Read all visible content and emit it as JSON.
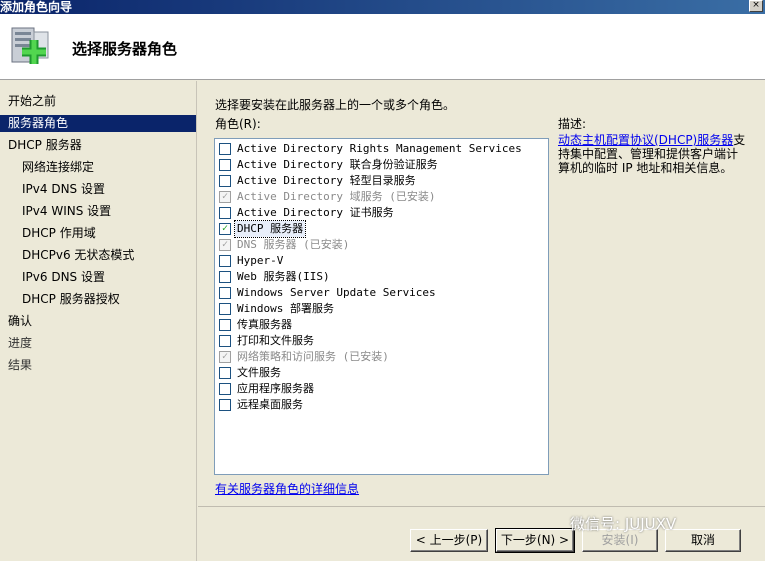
{
  "window": {
    "title": "添加角色向导",
    "close_glyph": "×"
  },
  "header": {
    "heading": "选择服务器角色",
    "icon": "server-add-icon"
  },
  "sidebar": {
    "items": [
      {
        "label": "开始之前",
        "level": 0,
        "state": "normal"
      },
      {
        "label": "服务器角色",
        "level": 0,
        "state": "active"
      },
      {
        "label": "DHCP 服务器",
        "level": 0,
        "state": "normal"
      },
      {
        "label": "网络连接绑定",
        "level": 1,
        "state": "normal"
      },
      {
        "label": "IPv4 DNS 设置",
        "level": 1,
        "state": "normal"
      },
      {
        "label": "IPv4 WINS 设置",
        "level": 1,
        "state": "normal"
      },
      {
        "label": "DHCP 作用域",
        "level": 1,
        "state": "normal"
      },
      {
        "label": "DHCPv6 无状态模式",
        "level": 1,
        "state": "normal"
      },
      {
        "label": "IPv6 DNS 设置",
        "level": 1,
        "state": "normal"
      },
      {
        "label": "DHCP 服务器授权",
        "level": 1,
        "state": "normal"
      },
      {
        "label": "确认",
        "level": 0,
        "state": "normal"
      },
      {
        "label": "进度",
        "level": 0,
        "state": "muted"
      },
      {
        "label": "结果",
        "level": 0,
        "state": "muted"
      }
    ]
  },
  "content": {
    "instruction": "选择要安装在此服务器上的一个或多个角色。",
    "roles_label": "角色(R):",
    "roles": [
      {
        "label": "Active Directory Rights Management Services",
        "checked": false,
        "installed": false
      },
      {
        "label": "Active Directory 联合身份验证服务",
        "checked": false,
        "installed": false
      },
      {
        "label": "Active Directory 轻型目录服务",
        "checked": false,
        "installed": false
      },
      {
        "label": "Active Directory 域服务  (已安装)",
        "checked": true,
        "installed": true
      },
      {
        "label": "Active Directory 证书服务",
        "checked": false,
        "installed": false
      },
      {
        "label": "DHCP 服务器",
        "checked": true,
        "installed": false,
        "selected": true
      },
      {
        "label": "DNS 服务器  (已安装)",
        "checked": true,
        "installed": true
      },
      {
        "label": "Hyper-V",
        "checked": false,
        "installed": false
      },
      {
        "label": "Web 服务器(IIS)",
        "checked": false,
        "installed": false
      },
      {
        "label": "Windows Server Update Services",
        "checked": false,
        "installed": false
      },
      {
        "label": "Windows 部署服务",
        "checked": false,
        "installed": false
      },
      {
        "label": "传真服务器",
        "checked": false,
        "installed": false
      },
      {
        "label": "打印和文件服务",
        "checked": false,
        "installed": false
      },
      {
        "label": "网络策略和访问服务  (已安装)",
        "checked": true,
        "installed": true
      },
      {
        "label": "文件服务",
        "checked": false,
        "installed": false
      },
      {
        "label": "应用程序服务器",
        "checked": false,
        "installed": false
      },
      {
        "label": "远程桌面服务",
        "checked": false,
        "installed": false
      }
    ],
    "more_info_link": "有关服务器角色的详细信息",
    "description": {
      "label": "描述:",
      "link_text": "动态主机配置协议(DHCP)服务器",
      "text": "支持集中配置、管理和提供客户端计算机的临时 IP 地址和相关信息。"
    }
  },
  "footer": {
    "back_label": "< 上一步(P)",
    "next_label": "下一步(N) >",
    "install_label": "安装(I)",
    "cancel_label": "取消"
  },
  "watermark": "微信号: JUJUXV",
  "colors": {
    "accent": "#0a246a",
    "link": "#0000ee",
    "background": "#ece9d8"
  }
}
